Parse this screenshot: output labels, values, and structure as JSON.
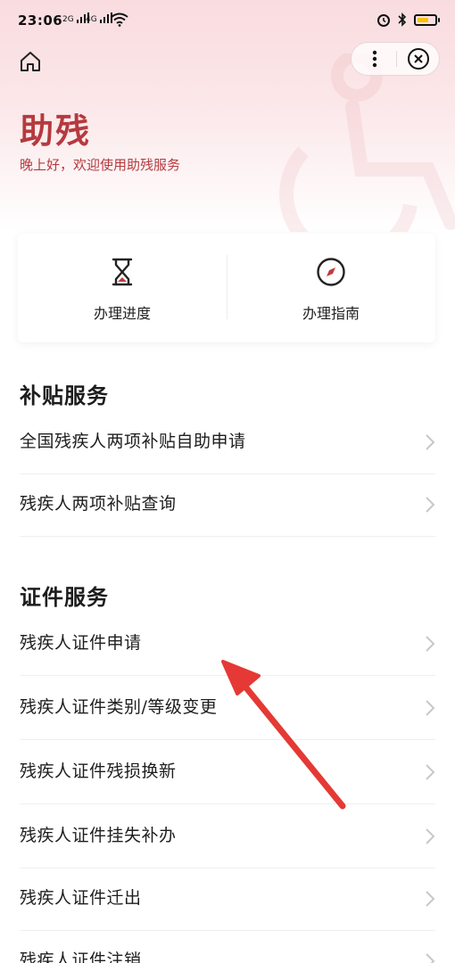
{
  "status_bar": {
    "time": "23:06",
    "signal1": "2G",
    "signal2": "4G"
  },
  "header": {
    "title": "助残",
    "subtitle": "晚上好，欢迎使用助残服务"
  },
  "quick_actions": [
    {
      "label": "办理进度",
      "icon": "hourglass-icon"
    },
    {
      "label": "办理指南",
      "icon": "compass-icon"
    }
  ],
  "sections": [
    {
      "title": "补贴服务",
      "items": [
        "全国残疾人两项补贴自助申请",
        "残疾人两项补贴查询"
      ]
    },
    {
      "title": "证件服务",
      "items": [
        "残疾人证件申请",
        "残疾人证件类别/等级变更",
        "残疾人证件残损换新",
        "残疾人证件挂失补办",
        "残疾人证件迁出",
        "残疾人证件注销"
      ]
    }
  ],
  "colors": {
    "accent": "#b53a3e",
    "annotation_arrow": "#e53935"
  }
}
